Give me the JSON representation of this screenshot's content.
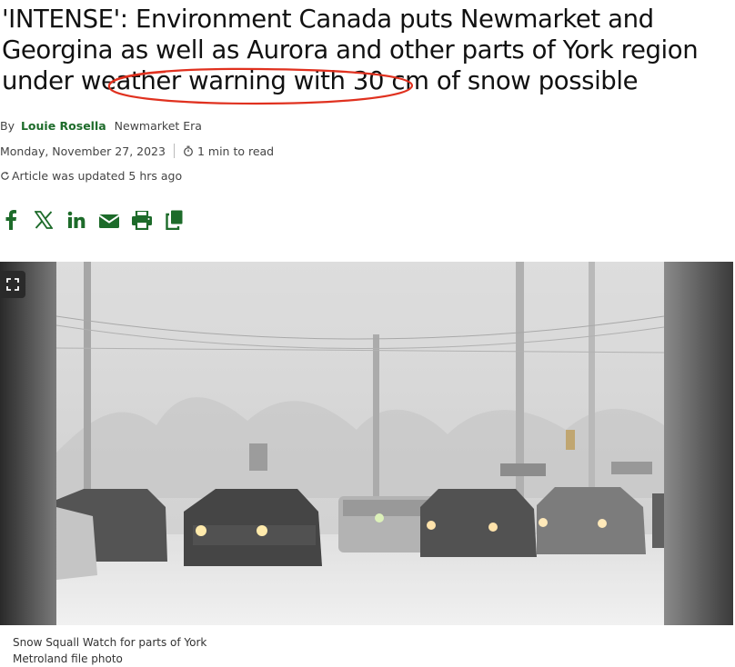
{
  "article": {
    "headline_main": "'INTENSE': Environment Canada puts Newmarket and Georgina as well as Aurora and other parts of York region under weather warning w",
    "headline_circled": "ith 30 cm of snow possible",
    "byline_prefix": "By",
    "author": "Louie Rosella",
    "publication": "Newmarket Era",
    "date": "Monday, November 27, 2023",
    "read_time": "1 min to read",
    "updated": "Article was updated 5 hrs ago"
  },
  "share": {
    "icons": [
      "facebook-icon",
      "x-icon",
      "linkedin-icon",
      "email-icon",
      "print-icon",
      "copy-icon"
    ],
    "color": "#1d6b2a"
  },
  "media": {
    "caption_line1": "Snow Squall Watch for parts of York",
    "caption_line2": "Metroland file photo",
    "fullscreen_icon": "expand-icon"
  },
  "colors": {
    "accent": "#1d6b2a",
    "annotation": "#e0311f"
  }
}
